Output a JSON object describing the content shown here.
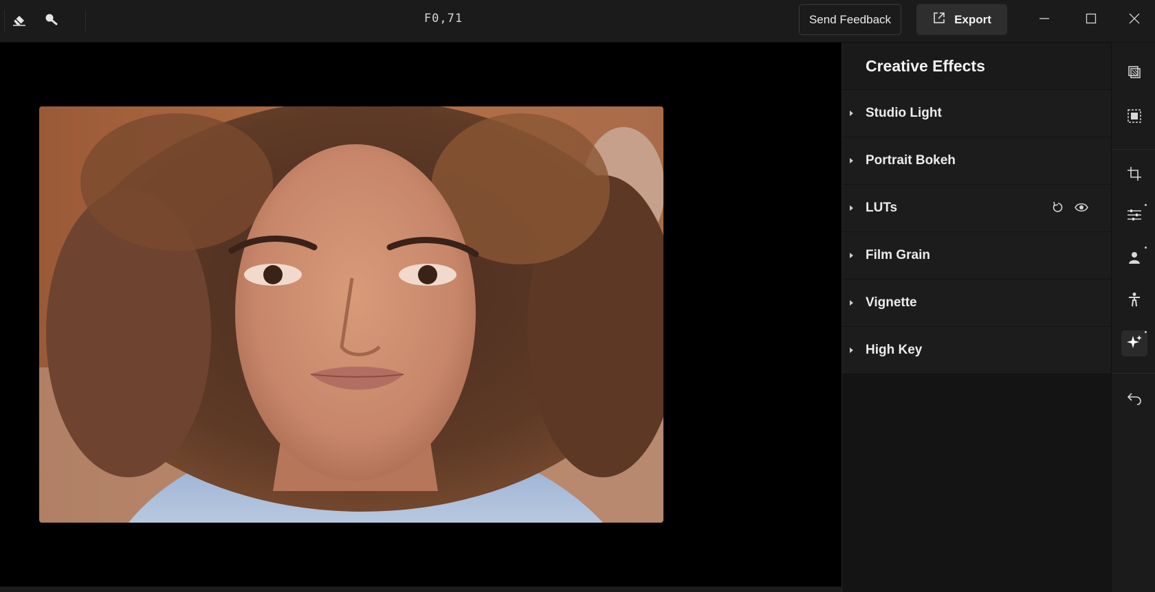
{
  "toolbar": {
    "file_name": "F0,71",
    "feedback_label": "Send Feedback",
    "export_label": "Export"
  },
  "icons": {
    "eraser": "eraser-icon",
    "magnifier": "magnifier-icon",
    "export": "external-link-icon",
    "minimize": "minimize-icon",
    "maximize": "maximize-icon",
    "close": "close-icon"
  },
  "panel": {
    "title": "Creative Effects",
    "effects": [
      {
        "label": "Studio Light"
      },
      {
        "label": "Portrait Bokeh"
      },
      {
        "label": "LUTs"
      },
      {
        "label": "Film Grain"
      },
      {
        "label": "Vignette"
      },
      {
        "label": "High Key"
      }
    ]
  },
  "rail": {
    "items": [
      "layers-icon",
      "select-subject-icon",
      "crop-icon",
      "adjustments-icon",
      "portrait-icon",
      "body-icon",
      "sparkle-icon",
      "undo-icon"
    ],
    "active": "sparkle-icon"
  },
  "colors": {
    "bg": "#000000",
    "bar": "#1b1b1b",
    "panel": "#1c1c1c",
    "text": "#ececec"
  }
}
